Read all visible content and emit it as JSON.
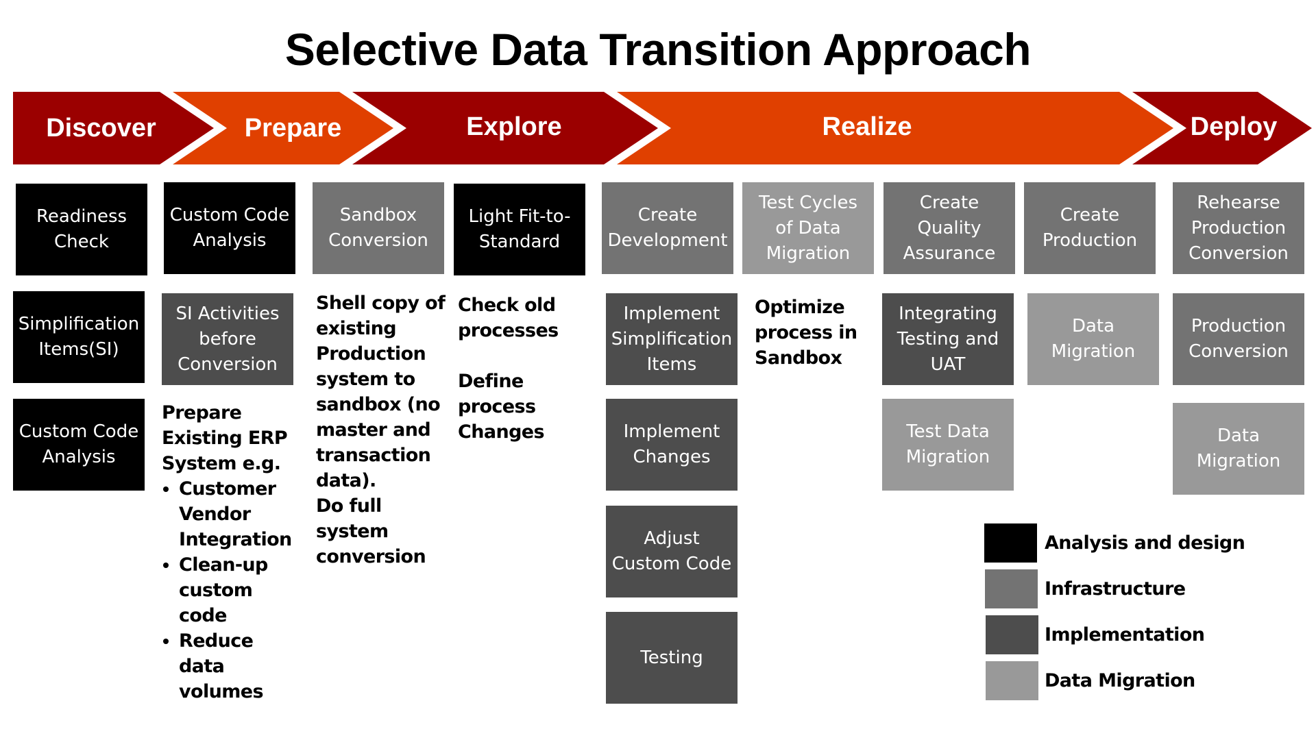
{
  "title": "Selective Data Transition Approach",
  "colors": {
    "phase_dark": "#9b0000",
    "phase_orange": "#e04000",
    "analysis_and_design": "#000000",
    "infrastructure": "#737373",
    "implementation": "#4d4d4d",
    "data_migration": "#999999"
  },
  "phases": [
    {
      "label": "Discover",
      "color": "dark"
    },
    {
      "label": "Prepare",
      "color": "orange"
    },
    {
      "label": "Explore",
      "color": "dark"
    },
    {
      "label": "Realize",
      "color": "orange"
    },
    {
      "label": "Deploy",
      "color": "dark"
    }
  ],
  "boxes": {
    "readiness_check": {
      "text": "Readiness\nCheck",
      "category": "Analysis and design"
    },
    "custom_code_analysis_prepare": {
      "text": "Custom Code\nAnalysis",
      "category": "Analysis and design"
    },
    "sandbox_conversion": {
      "text": "Sandbox\nConversion",
      "category": "Infrastructure"
    },
    "light_fit_to_standard": {
      "text": "Light Fit-to-\nStandard",
      "category": "Analysis and design"
    },
    "create_development": {
      "text": "Create\nDevelopment",
      "category": "Infrastructure"
    },
    "test_cycles": {
      "text": "Test Cycles\nof Data\nMigration",
      "category": "Data Migration"
    },
    "create_qa": {
      "text": "Create Quality\nAssurance",
      "category": "Infrastructure"
    },
    "create_production": {
      "text": "Create\nProduction",
      "category": "Infrastructure"
    },
    "rehearse_production": {
      "text": "Rehearse\nProduction\nConversion",
      "category": "Infrastructure"
    },
    "simplification_items": {
      "text": "Simplification\nItems(SI)",
      "category": "Analysis and design"
    },
    "si_activities": {
      "text": "SI Activities\nbefore\nConversion",
      "category": "Implementation"
    },
    "implement_si_items": {
      "text": "Implement\nSimplification\nItems",
      "category": "Implementation"
    },
    "integrating_testing": {
      "text": "Integrating\nTesting and\nUAT",
      "category": "Implementation"
    },
    "data_migration_prod": {
      "text": "Data\nMigration",
      "category": "Data Migration"
    },
    "production_conversion": {
      "text": "Production\nConversion",
      "category": "Infrastructure"
    },
    "custom_code_analysis_discover": {
      "text": "Custom Code\nAnalysis",
      "category": "Analysis and design"
    },
    "implement_changes": {
      "text": "Implement\nChanges",
      "category": "Implementation"
    },
    "test_data_migration": {
      "text": "Test Data\nMigration",
      "category": "Data Migration"
    },
    "data_migration_deploy": {
      "text": "Data\nMigration",
      "category": "Data Migration"
    },
    "adjust_custom_code": {
      "text": "Adjust\nCustom Code",
      "category": "Implementation"
    },
    "testing": {
      "text": "Testing",
      "category": "Implementation"
    }
  },
  "notes": {
    "prepare": {
      "intro": "Prepare Existing ERP System e.g.",
      "bullets": [
        "Customer Vendor Integration",
        "Clean-up custom code",
        "Reduce data volumes"
      ]
    },
    "sandbox": {
      "line1": "Shell copy of existing Production system to sandbox (no master and transaction data).",
      "line2": "Do full system conversion"
    },
    "explore": {
      "line1": "Check old processes",
      "line2": "Define process Changes"
    },
    "realize": {
      "line1": "Optimize process in Sandbox"
    }
  },
  "legend": [
    {
      "label": "Analysis and design",
      "color": "#000000"
    },
    {
      "label": "Infrastructure",
      "color": "#737373"
    },
    {
      "label": "Implementation",
      "color": "#4d4d4d"
    },
    {
      "label": "Data Migration",
      "color": "#999999"
    }
  ]
}
